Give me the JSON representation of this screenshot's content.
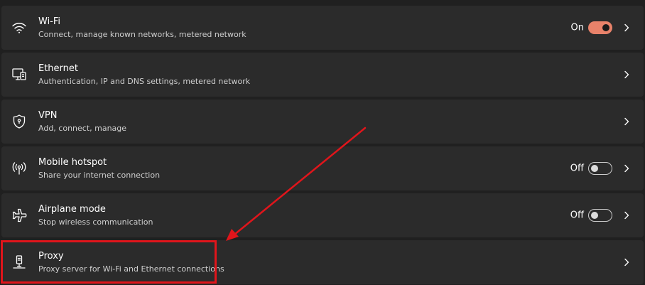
{
  "settings": {
    "wifi": {
      "title": "Wi-Fi",
      "subtitle": "Connect, manage known networks, metered network",
      "state": "On",
      "icon": "wifi-icon"
    },
    "ethernet": {
      "title": "Ethernet",
      "subtitle": "Authentication, IP and DNS settings, metered network",
      "icon": "ethernet-icon"
    },
    "vpn": {
      "title": "VPN",
      "subtitle": "Add, connect, manage",
      "icon": "shield-icon"
    },
    "hotspot": {
      "title": "Mobile hotspot",
      "subtitle": "Share your internet connection",
      "state": "Off",
      "icon": "hotspot-icon"
    },
    "airplane": {
      "title": "Airplane mode",
      "subtitle": "Stop wireless communication",
      "state": "Off",
      "icon": "airplane-icon"
    },
    "proxy": {
      "title": "Proxy",
      "subtitle": "Proxy server for Wi-Fi and Ethernet connections",
      "icon": "proxy-icon"
    }
  },
  "colors": {
    "background": "#202020",
    "row": "#2b2b2b",
    "accent": "#e8826a",
    "annotation": "#e0151b"
  }
}
